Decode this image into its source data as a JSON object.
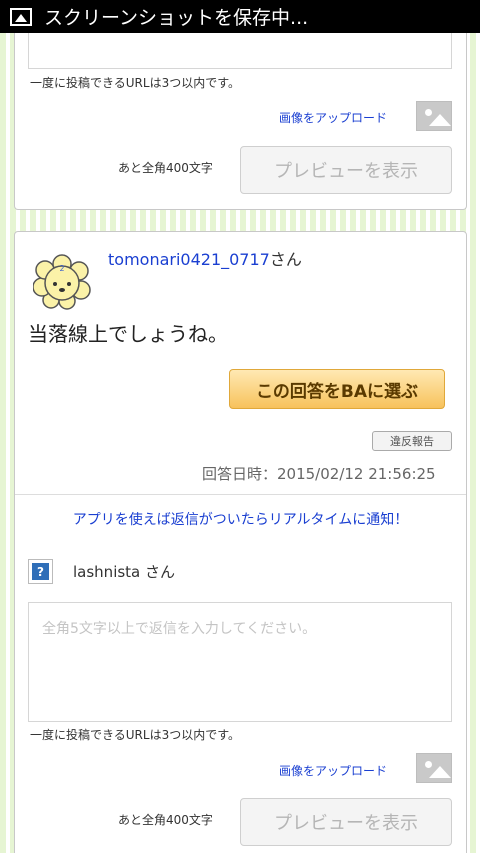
{
  "statusbar": {
    "title": "スクリーンショットを保存中..."
  },
  "top_form": {
    "url_note": "一度に投稿できるURLは3つ以内です。",
    "upload_label": "画像をアップロード",
    "remain_label": "あと全角400文字",
    "preview_label": "プレビューを表示"
  },
  "answer_card": {
    "username": "tomonari0421_0717",
    "username_suffix": "さん",
    "answer_text": "当落線上でしょうね。",
    "ba_button": "この回答をBAに選ぶ",
    "report_button": "違反報告",
    "answered_at": "回答日時：2015/02/12 21:56:25",
    "app_notice": "アプリを使えば返信がついたらリアルタイムに通知！",
    "reply_user": "lashnista さん",
    "reply_placeholder": "全角5文字以上で返信を入力してください。",
    "url_note": "一度に投稿できるURLは3つ以内です。",
    "upload_label": "画像をアップロード",
    "remain_label": "あと全角400文字",
    "preview_label": "プレビューを表示"
  }
}
